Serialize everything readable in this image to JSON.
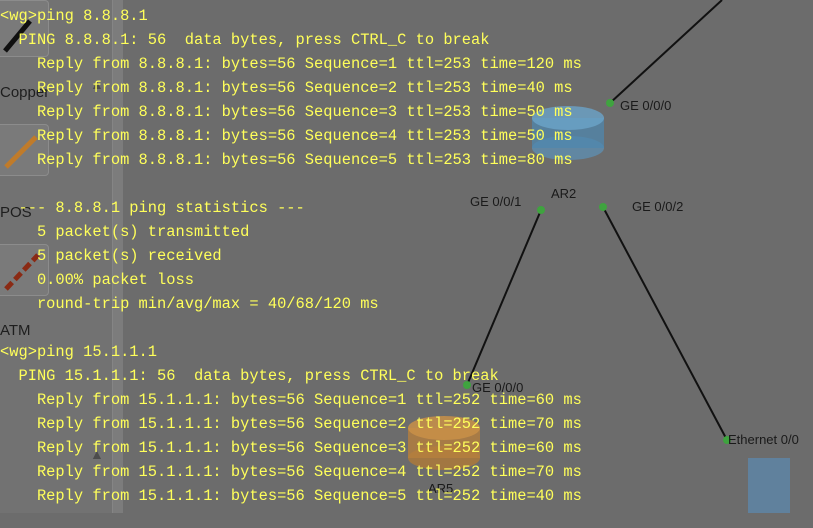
{
  "palette": {
    "labels": [
      "Copper",
      "POS",
      "ATM"
    ],
    "scroll_up": "▲",
    "scroll_down": "▲"
  },
  "topology": {
    "devices": [
      {
        "name": "AR2"
      },
      {
        "name": "AR5"
      }
    ],
    "ports": [
      "GE 0/0/0",
      "GE 0/0/1",
      "GE 0/0/2",
      "GE 0/0/0",
      "Ethernet 0/0"
    ],
    "colors": {
      "link": "#111111",
      "port_dot": "#3fa33f",
      "router": "#4aa0d8",
      "router_ar5": "#e59a35"
    }
  },
  "console": {
    "lines": [
      "<wg>ping 8.8.8.1",
      "  PING 8.8.8.1: 56  data bytes, press CTRL_C to break",
      "    Reply from 8.8.8.1: bytes=56 Sequence=1 ttl=253 time=120 ms",
      "    Reply from 8.8.8.1: bytes=56 Sequence=2 ttl=253 time=40 ms",
      "    Reply from 8.8.8.1: bytes=56 Sequence=3 ttl=253 time=50 ms",
      "    Reply from 8.8.8.1: bytes=56 Sequence=4 ttl=253 time=50 ms",
      "    Reply from 8.8.8.1: bytes=56 Sequence=5 ttl=253 time=80 ms",
      "",
      "  --- 8.8.8.1 ping statistics ---",
      "    5 packet(s) transmitted",
      "    5 packet(s) received",
      "    0.00% packet loss",
      "    round-trip min/avg/max = 40/68/120 ms",
      "",
      "<wg>ping 15.1.1.1",
      "  PING 15.1.1.1: 56  data bytes, press CTRL_C to break",
      "    Reply from 15.1.1.1: bytes=56 Sequence=1 ttl=252 time=60 ms",
      "    Reply from 15.1.1.1: bytes=56 Sequence=2 ttl=252 time=70 ms",
      "    Reply from 15.1.1.1: bytes=56 Sequence=3 ttl=252 time=60 ms",
      "    Reply from 15.1.1.1: bytes=56 Sequence=4 ttl=252 time=70 ms",
      "    Reply from 15.1.1.1: bytes=56 Sequence=5 ttl=252 time=40 ms"
    ]
  }
}
